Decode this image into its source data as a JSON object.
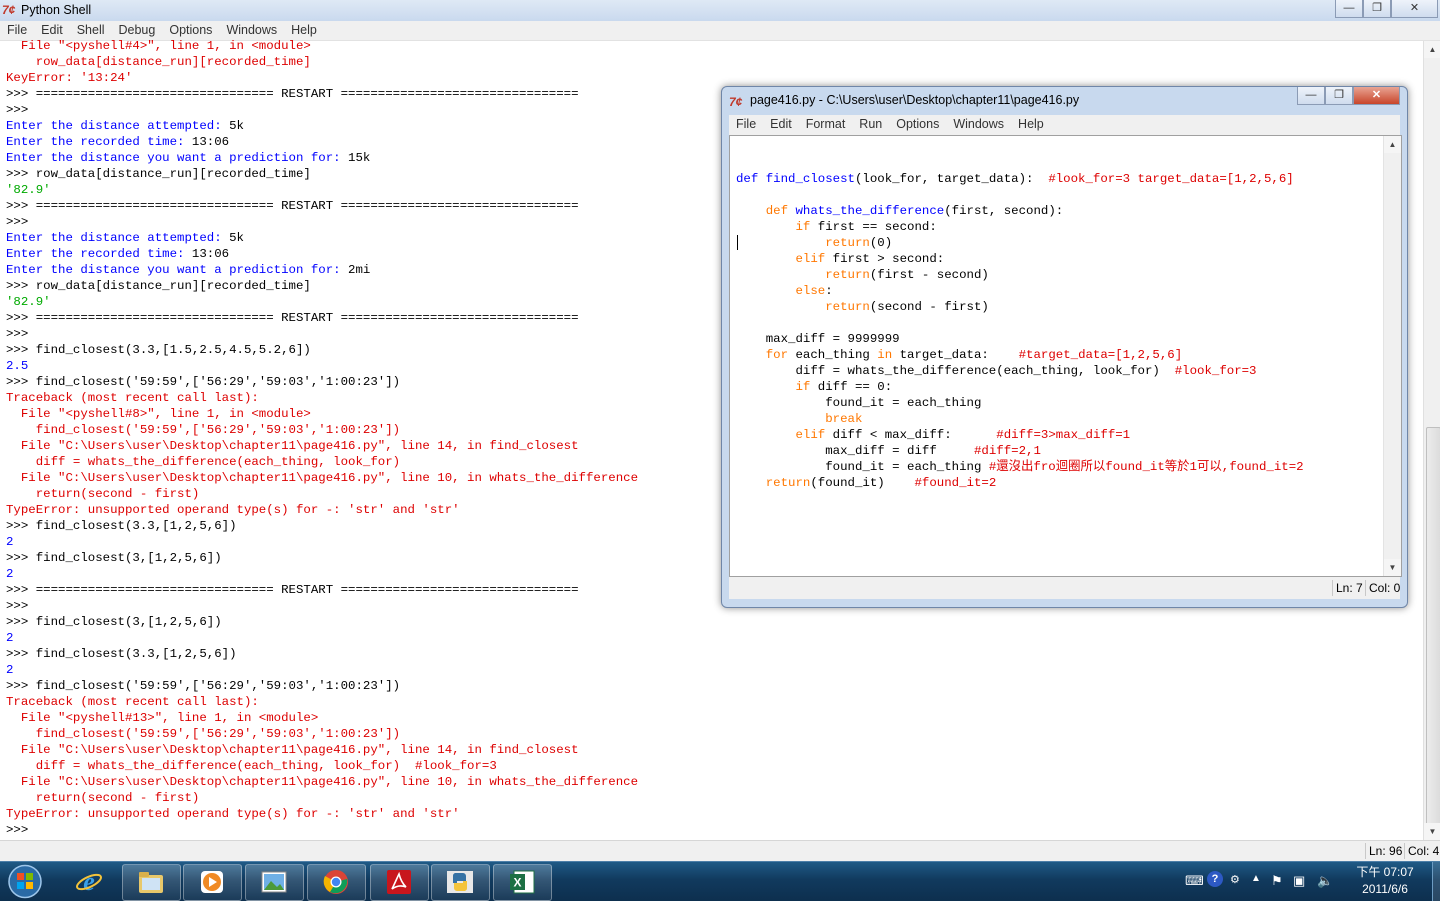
{
  "shell": {
    "title": "Python Shell",
    "menu": [
      "File",
      "Edit",
      "Shell",
      "Debug",
      "Options",
      "Windows",
      "Help"
    ],
    "lines": [
      {
        "c": "sh-err",
        "t": "  File \"<pyshell#4>\", line 1, in <module>"
      },
      {
        "c": "sh-err",
        "t": "    row_data[distance_run][recorded_time]"
      },
      {
        "c": "sh-err",
        "t": "KeyError: '13:24'"
      },
      {
        "c": "sh-prompt",
        "t": ">>> ================================ RESTART ================================"
      },
      {
        "c": "sh-prompt",
        "t": ">>> "
      },
      {
        "c": "sh-out",
        "t": "Enter the distance attempted: ",
        "t2": "5k"
      },
      {
        "c": "sh-out",
        "t": "Enter the recorded time: ",
        "t2": "13:06"
      },
      {
        "c": "sh-out",
        "t": "Enter the distance you want a prediction for: ",
        "t2": "15k"
      },
      {
        "c": "sh-prompt",
        "t": ">>> row_data[distance_run][recorded_time]"
      },
      {
        "c": "sh-str",
        "t": "'82.9'"
      },
      {
        "c": "sh-prompt",
        "t": ">>> ================================ RESTART ================================"
      },
      {
        "c": "sh-prompt",
        "t": ">>> "
      },
      {
        "c": "sh-out",
        "t": "Enter the distance attempted: ",
        "t2": "5k"
      },
      {
        "c": "sh-out",
        "t": "Enter the recorded time: ",
        "t2": "13:06"
      },
      {
        "c": "sh-out",
        "t": "Enter the distance you want a prediction for: ",
        "t2": "2mi"
      },
      {
        "c": "sh-prompt",
        "t": ">>> row_data[distance_run][recorded_time]"
      },
      {
        "c": "sh-str",
        "t": "'82.9'"
      },
      {
        "c": "sh-prompt",
        "t": ">>> ================================ RESTART ================================"
      },
      {
        "c": "sh-prompt",
        "t": ">>> "
      },
      {
        "c": "sh-prompt",
        "t": ">>> find_closest(3.3,[1.5,2.5,4.5,5.2,6])"
      },
      {
        "c": "sh-out",
        "t": "2.5"
      },
      {
        "c": "sh-prompt",
        "t": ">>> find_closest('59:59',['56:29','59:03','1:00:23'])"
      },
      {
        "c": "sh-err",
        "t": "Traceback (most recent call last):"
      },
      {
        "c": "sh-err",
        "t": "  File \"<pyshell#8>\", line 1, in <module>"
      },
      {
        "c": "sh-err",
        "t": "    find_closest('59:59',['56:29','59:03','1:00:23'])"
      },
      {
        "c": "sh-err",
        "t": "  File \"C:\\Users\\user\\Desktop\\chapter11\\page416.py\", line 14, in find_closest"
      },
      {
        "c": "sh-err",
        "t": "    diff = whats_the_difference(each_thing, look_for)"
      },
      {
        "c": "sh-err",
        "t": "  File \"C:\\Users\\user\\Desktop\\chapter11\\page416.py\", line 10, in whats_the_difference"
      },
      {
        "c": "sh-err",
        "t": "    return(second - first)"
      },
      {
        "c": "sh-err",
        "t": "TypeError: unsupported operand type(s) for -: 'str' and 'str'"
      },
      {
        "c": "sh-prompt",
        "t": ">>> find_closest(3.3,[1,2,5,6])"
      },
      {
        "c": "sh-out",
        "t": "2"
      },
      {
        "c": "sh-prompt",
        "t": ">>> find_closest(3,[1,2,5,6])"
      },
      {
        "c": "sh-out",
        "t": "2"
      },
      {
        "c": "sh-prompt",
        "t": ">>> ================================ RESTART ================================"
      },
      {
        "c": "sh-prompt",
        "t": ">>> "
      },
      {
        "c": "sh-prompt",
        "t": ">>> find_closest(3,[1,2,5,6])"
      },
      {
        "c": "sh-out",
        "t": "2"
      },
      {
        "c": "sh-prompt",
        "t": ">>> find_closest(3.3,[1,2,5,6])"
      },
      {
        "c": "sh-out",
        "t": "2"
      },
      {
        "c": "sh-prompt",
        "t": ">>> find_closest('59:59',['56:29','59:03','1:00:23'])"
      },
      {
        "c": "sh-err",
        "t": "Traceback (most recent call last):"
      },
      {
        "c": "sh-err",
        "t": "  File \"<pyshell#13>\", line 1, in <module>"
      },
      {
        "c": "sh-err",
        "t": "    find_closest('59:59',['56:29','59:03','1:00:23'])"
      },
      {
        "c": "sh-err",
        "t": "  File \"C:\\Users\\user\\Desktop\\chapter11\\page416.py\", line 14, in find_closest"
      },
      {
        "c": "sh-err",
        "t": "    diff = whats_the_difference(each_thing, look_for)  #look_for=3"
      },
      {
        "c": "sh-err",
        "t": "  File \"C:\\Users\\user\\Desktop\\chapter11\\page416.py\", line 10, in whats_the_difference"
      },
      {
        "c": "sh-err",
        "t": "    return(second - first)"
      },
      {
        "c": "sh-err",
        "t": "TypeError: unsupported operand type(s) for -: 'str' and 'str'"
      },
      {
        "c": "sh-prompt",
        "t": ">>> "
      }
    ],
    "status": {
      "ln": "Ln: 96",
      "col": "Col: 4"
    }
  },
  "editor": {
    "title": "page416.py - C:\\Users\\user\\Desktop\\chapter11\\page416.py",
    "menu": [
      "File",
      "Edit",
      "Format",
      "Run",
      "Options",
      "Windows",
      "Help"
    ],
    "code": [
      [],
      [
        [
          "df",
          "def "
        ],
        [
          "df",
          "find_closest"
        ],
        [
          "tx",
          "(look_for, target_data):  "
        ],
        [
          "cm",
          "#look_for=3 target_data=[1,2,5,6]"
        ]
      ],
      [],
      [
        [
          "tx",
          "    "
        ],
        [
          "kw",
          "def "
        ],
        [
          "df",
          "whats_the_difference"
        ],
        [
          "tx",
          "(first, second):"
        ]
      ],
      [
        [
          "tx",
          "        "
        ],
        [
          "kw",
          "if"
        ],
        [
          "tx",
          " first == second:"
        ]
      ],
      [
        [
          "tx",
          "            "
        ],
        [
          "kw",
          "return"
        ],
        [
          "tx",
          "(0)"
        ]
      ],
      [
        [
          "tx",
          "        "
        ],
        [
          "kw",
          "elif"
        ],
        [
          "tx",
          " first > second:"
        ]
      ],
      [
        [
          "tx",
          "            "
        ],
        [
          "kw",
          "return"
        ],
        [
          "tx",
          "(first - second)"
        ]
      ],
      [
        [
          "tx",
          "        "
        ],
        [
          "kw",
          "else"
        ],
        [
          "tx",
          ":"
        ]
      ],
      [
        [
          "tx",
          "            "
        ],
        [
          "kw",
          "return"
        ],
        [
          "tx",
          "(second - first)"
        ]
      ],
      [],
      [
        [
          "tx",
          "    max_diff = 9999999"
        ]
      ],
      [
        [
          "tx",
          "    "
        ],
        [
          "kw",
          "for"
        ],
        [
          "tx",
          " each_thing "
        ],
        [
          "kw",
          "in"
        ],
        [
          "tx",
          " target_data:    "
        ],
        [
          "cm",
          "#target_data=[1,2,5,6]"
        ]
      ],
      [
        [
          "tx",
          "        diff = whats_the_difference(each_thing, look_for)  "
        ],
        [
          "cm",
          "#look_for=3"
        ]
      ],
      [
        [
          "tx",
          "        "
        ],
        [
          "kw",
          "if"
        ],
        [
          "tx",
          " diff == 0:"
        ]
      ],
      [
        [
          "tx",
          "            found_it = each_thing"
        ]
      ],
      [
        [
          "tx",
          "            "
        ],
        [
          "kw",
          "break"
        ]
      ],
      [
        [
          "tx",
          "        "
        ],
        [
          "kw",
          "elif"
        ],
        [
          "tx",
          " diff < max_diff:      "
        ],
        [
          "cm",
          "#diff=3>max_diff=1"
        ]
      ],
      [
        [
          "tx",
          "            max_diff = diff     "
        ],
        [
          "cm",
          "#diff=2,1"
        ]
      ],
      [
        [
          "tx",
          "            found_it = each_thing "
        ],
        [
          "cm",
          "#還沒出fro迴圈所以found_it等於1可以,found_it=2"
        ]
      ],
      [
        [
          "tx",
          "    "
        ],
        [
          "kw",
          "return"
        ],
        [
          "tx",
          "(found_it)    "
        ],
        [
          "cm",
          "#found_it=2"
        ]
      ]
    ],
    "status": {
      "ln": "Ln: 7",
      "col": "Col: 0"
    }
  },
  "taskbar": {
    "apps": [
      "internet-explorer",
      "windows-explorer",
      "media-player",
      "picture-viewer",
      "chrome",
      "adobe-reader",
      "python-idle",
      "excel"
    ],
    "clock_time": "下午 07:07",
    "clock_date": "2011/6/6"
  },
  "colors": {
    "keyword": "#ff7700",
    "definition": "#0000ff",
    "comment": "#dd0000",
    "string": "#00aa00",
    "error": "#dd0000",
    "output": "#0000ff"
  }
}
